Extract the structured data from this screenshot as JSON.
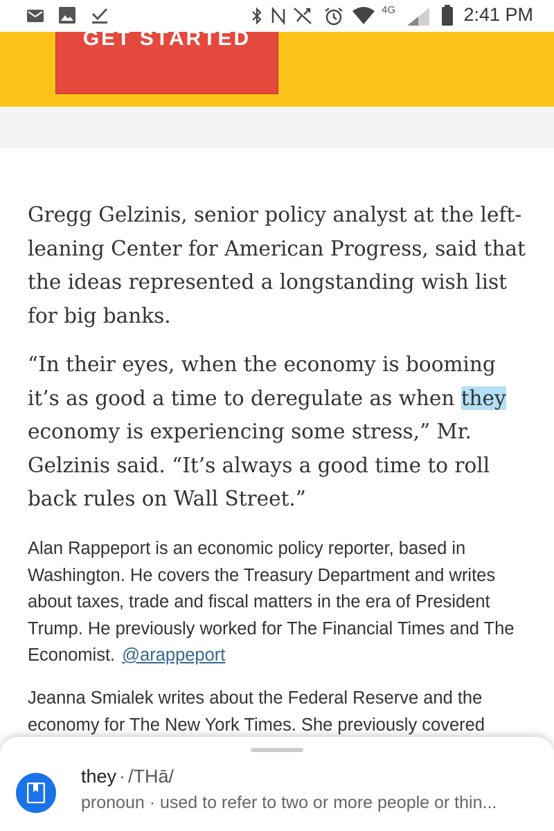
{
  "status_bar": {
    "time": "2:41 PM",
    "network": "4G",
    "icons": [
      "mail-icon",
      "image-icon",
      "download-icon",
      "bluetooth-icon",
      "nfc-icon",
      "sync-off-icon",
      "alarm-icon",
      "wifi-icon",
      "signal-icon",
      "battery-icon"
    ]
  },
  "promo": {
    "button_label": "GET STARTED",
    "colors": {
      "banner": "#fcc419",
      "button": "#e5483c"
    }
  },
  "article": {
    "p1": "Gregg Gelzinis, senior policy analyst at the left-leaning Center for American Progress, said that the ideas represented a longstanding wish list for big banks.",
    "p2_before": "“In their eyes, when the economy is booming it’s as good a time to deregulate as when ",
    "p2_selected": "they",
    "p2_after": " economy is experiencing some stress,” Mr. Gelzinis said. “It’s always a good time to roll back rules on Wall Street.”"
  },
  "bios": {
    "bio1": "Alan Rappeport is an economic policy reporter, based in Washington. He covers the Treasury Department and writes about taxes, trade and fiscal matters in the era of President Trump. He previously worked for The Financial Times and The Economist.",
    "bio1_twitter": "@arappeport",
    "bio2": "Jeanna Smialek writes about the Federal Reserve and the economy for The New York Times. She previously covered"
  },
  "definition_sheet": {
    "word": "they",
    "separator": "·",
    "pronunciation": "/THā/",
    "definition": "pronoun · used to refer to two or more people or thin..."
  }
}
